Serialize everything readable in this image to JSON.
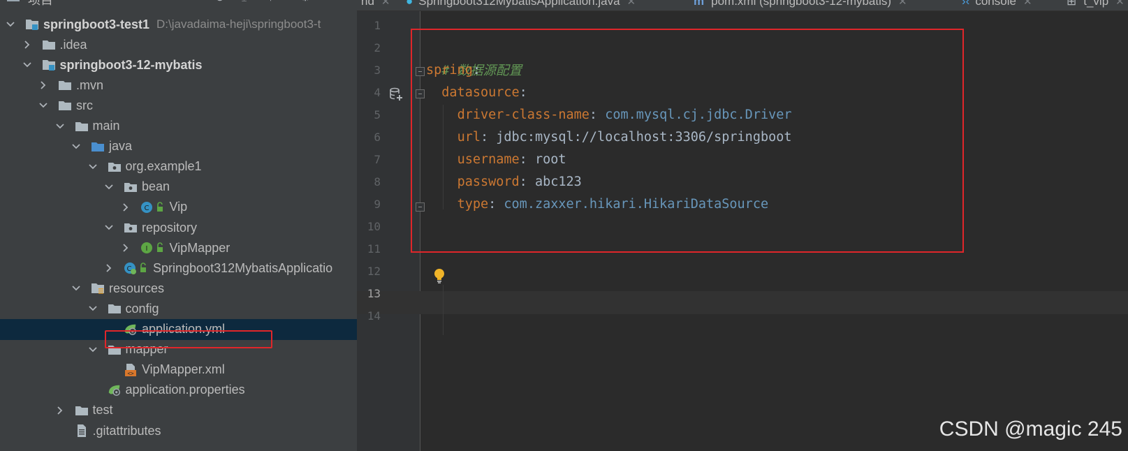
{
  "project_panel": {
    "title": "项目",
    "tree": [
      {
        "label": "springboot3-test1",
        "path": "D:\\javadaima-heji\\springboot3-t",
        "bold": true,
        "expanded": true,
        "icon": "module-icon"
      },
      {
        "label": ".idea",
        "expanded": false,
        "icon": "folder-icon"
      },
      {
        "label": "springboot3-12-mybatis",
        "bold": true,
        "expanded": true,
        "icon": "module-icon"
      },
      {
        "label": ".mvn",
        "expanded": false,
        "icon": "folder-icon"
      },
      {
        "label": "src",
        "expanded": true,
        "icon": "folder-icon"
      },
      {
        "label": "main",
        "expanded": true,
        "icon": "folder-icon"
      },
      {
        "label": "java",
        "expanded": true,
        "icon": "source-folder-icon"
      },
      {
        "label": "org.example1",
        "expanded": true,
        "icon": "package-icon"
      },
      {
        "label": "bean",
        "expanded": true,
        "icon": "package-icon"
      },
      {
        "label": "Vip",
        "expanded": false,
        "icon": "class-icon"
      },
      {
        "label": "repository",
        "expanded": true,
        "icon": "package-icon"
      },
      {
        "label": "VipMapper",
        "expanded": false,
        "icon": "interface-icon"
      },
      {
        "label": "Springboot312MybatisApplicatio",
        "expanded": false,
        "icon": "spring-boot-class-icon"
      },
      {
        "label": "resources",
        "expanded": true,
        "icon": "resources-folder-icon"
      },
      {
        "label": "config",
        "expanded": true,
        "icon": "folder-icon"
      },
      {
        "label": "application.yml",
        "icon": "spring-config-icon",
        "selected": true
      },
      {
        "label": "mapper",
        "expanded": true,
        "icon": "folder-icon"
      },
      {
        "label": "VipMapper.xml",
        "icon": "xml-file-icon"
      },
      {
        "label": "application.properties",
        "icon": "spring-config-icon"
      },
      {
        "label": "test",
        "expanded": false,
        "icon": "folder-icon"
      },
      {
        "label": ".gitattributes",
        "icon": "text-file-icon"
      }
    ]
  },
  "tabs": [
    {
      "label": "nd"
    },
    {
      "label": "Springboot312MybatisApplication.java"
    },
    {
      "label": "pom.xml (springboot3-12-mybatis)"
    },
    {
      "label": "console"
    },
    {
      "label": "t_vip"
    }
  ],
  "editor": {
    "line_numbers": [
      "1",
      "2",
      "3",
      "4",
      "5",
      "6",
      "7",
      "8",
      "9",
      "10",
      "11",
      "12",
      "13",
      "14"
    ],
    "current_line": "13",
    "lines": {
      "comment": "# 数据源配置",
      "spring_key": "spring",
      "datasource_key": "datasource",
      "driver_key": "driver-class-name",
      "driver_val": "com.mysql.cj.jdbc.Driver",
      "url_key": "url",
      "url_val": "jdbc:mysql://localhost:3306/springboot",
      "username_key": "username",
      "username_val": "root",
      "password_key": "password",
      "password_val": "abc123",
      "type_key": "type",
      "type_val": "com.zaxxer.hikari.HikariDataSource",
      "colon": ":"
    }
  },
  "watermark": "CSDN @magic 245",
  "colors": {
    "keyword": "#cc7832",
    "class_value": "#6897bb",
    "comment": "#629755",
    "highlight_box": "#e0262a",
    "selection": "#0d293e"
  }
}
